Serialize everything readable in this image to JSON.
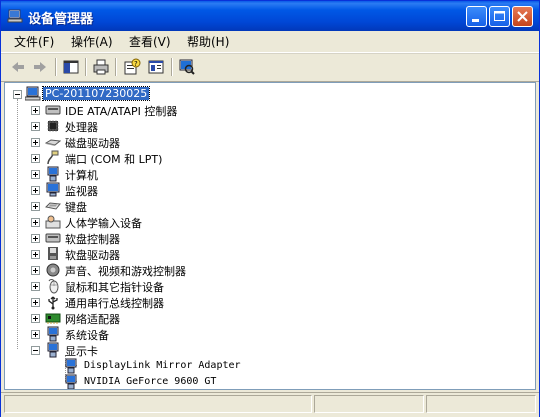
{
  "window": {
    "title": "设备管理器"
  },
  "menu": [
    "文件(F)",
    "操作(A)",
    "查看(V)",
    "帮助(H)"
  ],
  "tree": {
    "root": "PC-201107230025",
    "categories": [
      {
        "label": "IDE ATA/ATAPI 控制器",
        "icon": "ide-icon"
      },
      {
        "label": "处理器",
        "icon": "cpu-icon"
      },
      {
        "label": "磁盘驱动器",
        "icon": "disk-icon"
      },
      {
        "label": "端口 (COM 和 LPT)",
        "icon": "port-icon"
      },
      {
        "label": "计算机",
        "icon": "computer-icon"
      },
      {
        "label": "监视器",
        "icon": "monitor-icon"
      },
      {
        "label": "键盘",
        "icon": "keyboard-icon"
      },
      {
        "label": "人体学输入设备",
        "icon": "hid-icon"
      },
      {
        "label": "软盘控制器",
        "icon": "floppy-controller-icon"
      },
      {
        "label": "软盘驱动器",
        "icon": "floppy-drive-icon"
      },
      {
        "label": "声音、视频和游戏控制器",
        "icon": "sound-icon"
      },
      {
        "label": "鼠标和其它指针设备",
        "icon": "mouse-icon"
      },
      {
        "label": "通用串行总线控制器",
        "icon": "usb-icon"
      },
      {
        "label": "网络适配器",
        "icon": "network-icon"
      },
      {
        "label": "系统设备",
        "icon": "system-icon"
      },
      {
        "label": "显示卡",
        "icon": "display-icon"
      }
    ],
    "display_children": [
      "DisplayLink Mirror Adapter",
      "NVIDIA GeForce 9600 GT"
    ]
  }
}
